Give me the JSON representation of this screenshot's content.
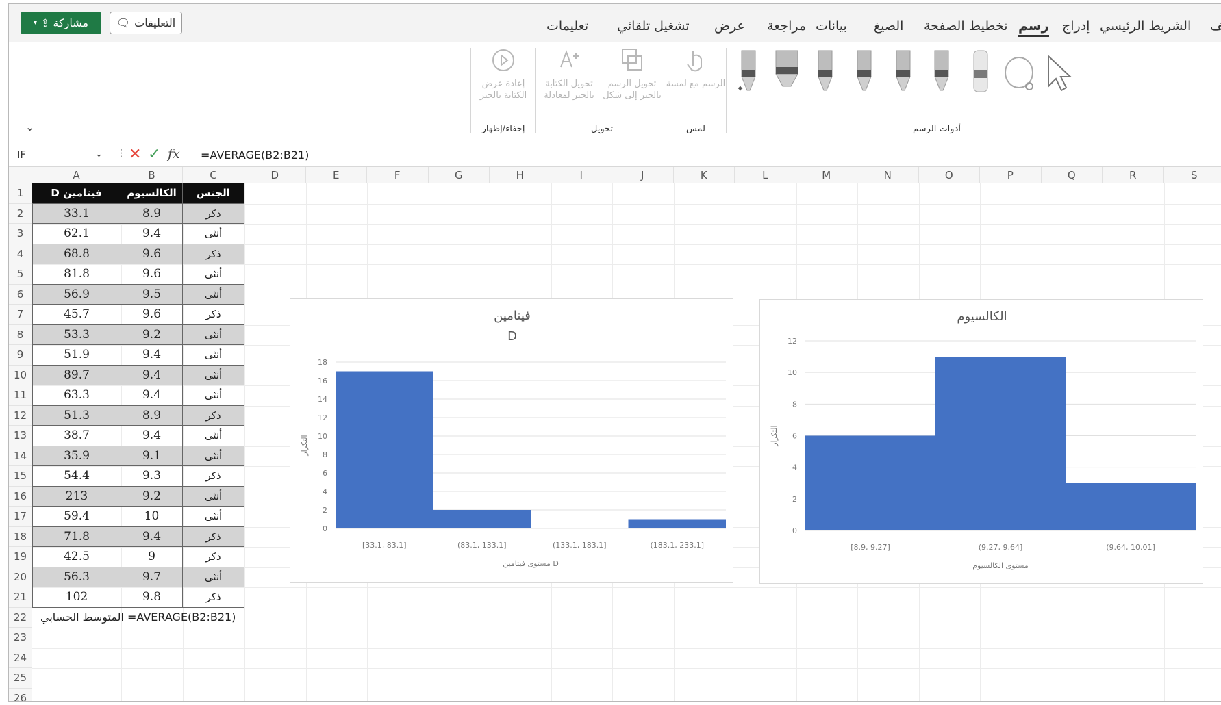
{
  "tabs": [
    "ملف",
    "الشريط الرئيسي",
    "إدراج",
    "رسم",
    "تخطيط الصفحة",
    "الصيغ",
    "بيانات",
    "مراجعة",
    "عرض",
    "تشغيل تلقائي",
    "تعليمات"
  ],
  "active_tab": "رسم",
  "share_label": "مشاركة",
  "comments_label": "التعليقات",
  "ribbon": {
    "groups": {
      "draw_tools": "أدوات الرسم",
      "touch": "لمس",
      "convert": "تحويل",
      "undo": "إخفاء/إظهار"
    },
    "buttons": {
      "draw_with_touch": "الرسم مع لمسة",
      "ink_to_shape": "تحويل الرسم بالحبر إلى شكل",
      "ink_to_math": "تحويل الكتابة بالحبر لمعادلة",
      "ink_replay": "إعادة عرض الكتابة بالحبر"
    }
  },
  "name_box": "IF",
  "formula": "=AVERAGE(B2:B21)",
  "columns": [
    "A",
    "B",
    "C",
    "D",
    "E",
    "F",
    "G",
    "H",
    "I",
    "J",
    "K",
    "L",
    "M",
    "N",
    "O",
    "P",
    "Q",
    "R",
    "S"
  ],
  "rows": [
    "1",
    "2",
    "3",
    "4",
    "5",
    "6",
    "7",
    "8",
    "9",
    "10",
    "11",
    "12",
    "13",
    "14",
    "15",
    "16",
    "17",
    "18",
    "19",
    "20",
    "21",
    "22",
    "23",
    "24",
    "25",
    "26"
  ],
  "table": {
    "headers": [
      "فيتامين D",
      "الكالسيوم",
      "الجنس"
    ],
    "rows": [
      [
        "33.1",
        "8.9",
        "ذكر"
      ],
      [
        "62.1",
        "9.4",
        "أنثى"
      ],
      [
        "68.8",
        "9.6",
        "ذكر"
      ],
      [
        "81.8",
        "9.6",
        "أنثى"
      ],
      [
        "56.9",
        "9.5",
        "أنثى"
      ],
      [
        "45.7",
        "9.6",
        "ذكر"
      ],
      [
        "53.3",
        "9.2",
        "أنثى"
      ],
      [
        "51.9",
        "9.4",
        "أنثى"
      ],
      [
        "89.7",
        "9.4",
        "أنثى"
      ],
      [
        "63.3",
        "9.4",
        "أنثى"
      ],
      [
        "51.3",
        "8.9",
        "ذكر"
      ],
      [
        "38.7",
        "9.4",
        "أنثى"
      ],
      [
        "35.9",
        "9.1",
        "أنثى"
      ],
      [
        "54.4",
        "9.3",
        "ذكر"
      ],
      [
        "213",
        "9.2",
        "أنثى"
      ],
      [
        "59.4",
        "10",
        "أنثى"
      ],
      [
        "71.8",
        "9.4",
        "ذكر"
      ],
      [
        "42.5",
        "9",
        "ذكر"
      ],
      [
        "56.3",
        "9.7",
        "أنثى"
      ],
      [
        "102",
        "9.8",
        "ذكر"
      ]
    ]
  },
  "avg_label": "المتوسط الحسابي =AVERAGE(B2:B21)",
  "colors": {
    "bar": "#4472c4",
    "share": "#1f7a45",
    "header_bg": "#0e0e0e",
    "alt_row": "#d4d4d4"
  },
  "chart_data": [
    {
      "type": "bar",
      "title": "فيتامين D",
      "categories": [
        "[33.1, 83.1]",
        "(83.1, 133.1]",
        "(133.1, 183.1]",
        "(183.1, 233.1]"
      ],
      "values": [
        17,
        2,
        0,
        1
      ],
      "xlabel": "مستوى فيتامين D",
      "ylabel": "التكرار",
      "ylim": [
        0,
        18
      ],
      "yticks": [
        0,
        2,
        4,
        6,
        8,
        10,
        12,
        14,
        16,
        18
      ]
    },
    {
      "type": "bar",
      "title": "الكالسيوم",
      "categories": [
        "[8.9, 9.27]",
        "(9.27, 9.64]",
        "(9.64, 10.01]"
      ],
      "values": [
        6,
        11,
        3
      ],
      "xlabel": "مستوى الكالسيوم",
      "ylabel": "التكرار",
      "ylim": [
        0,
        12
      ],
      "yticks": [
        0,
        2,
        4,
        6,
        8,
        10,
        12
      ]
    }
  ]
}
